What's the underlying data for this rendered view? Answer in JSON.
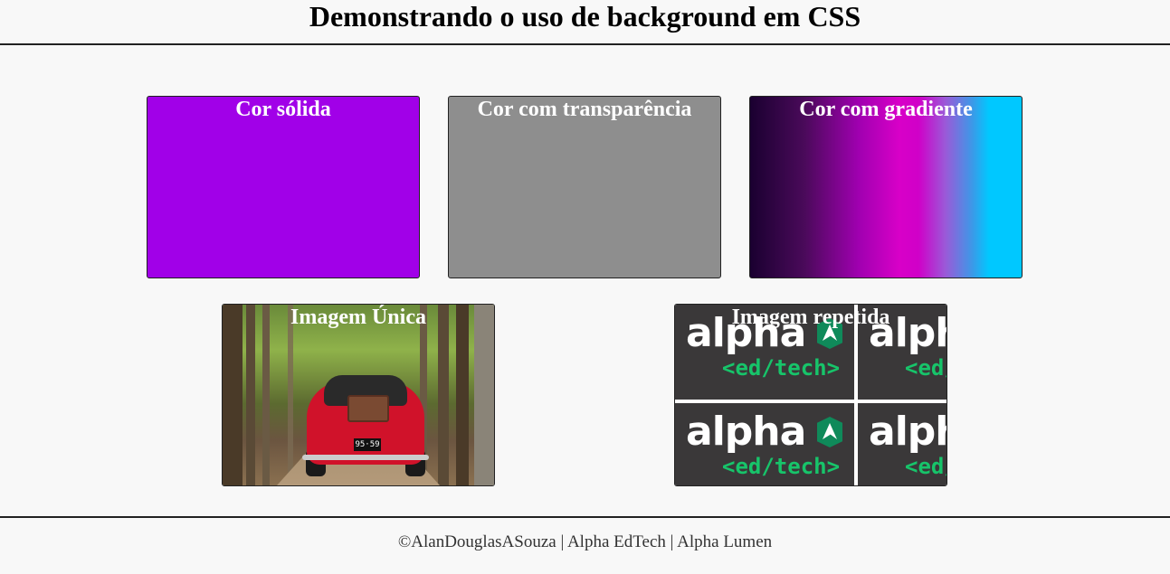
{
  "header": {
    "title": "Demonstrando o uso de background em CSS"
  },
  "boxes": {
    "solid": {
      "title": "Cor sólida",
      "color": "#a100e8"
    },
    "transparent": {
      "title": "Cor com transparência",
      "color": "#8e8e8e"
    },
    "gradient": {
      "title": "Cor com gradiente",
      "colors": [
        "#1a0030",
        "#d800c8",
        "#00c8ff"
      ]
    },
    "single_image": {
      "title": "Imagem Única",
      "plate": "95·59"
    },
    "repeated_image": {
      "title": "Imagem repetida",
      "logo_word": "alpha",
      "logo_sub": "<ed/tech>",
      "logo_color": "#17c46a"
    }
  },
  "footer": {
    "text": "©AlanDouglasASouza | Alpha EdTech | Alpha Lumen"
  }
}
